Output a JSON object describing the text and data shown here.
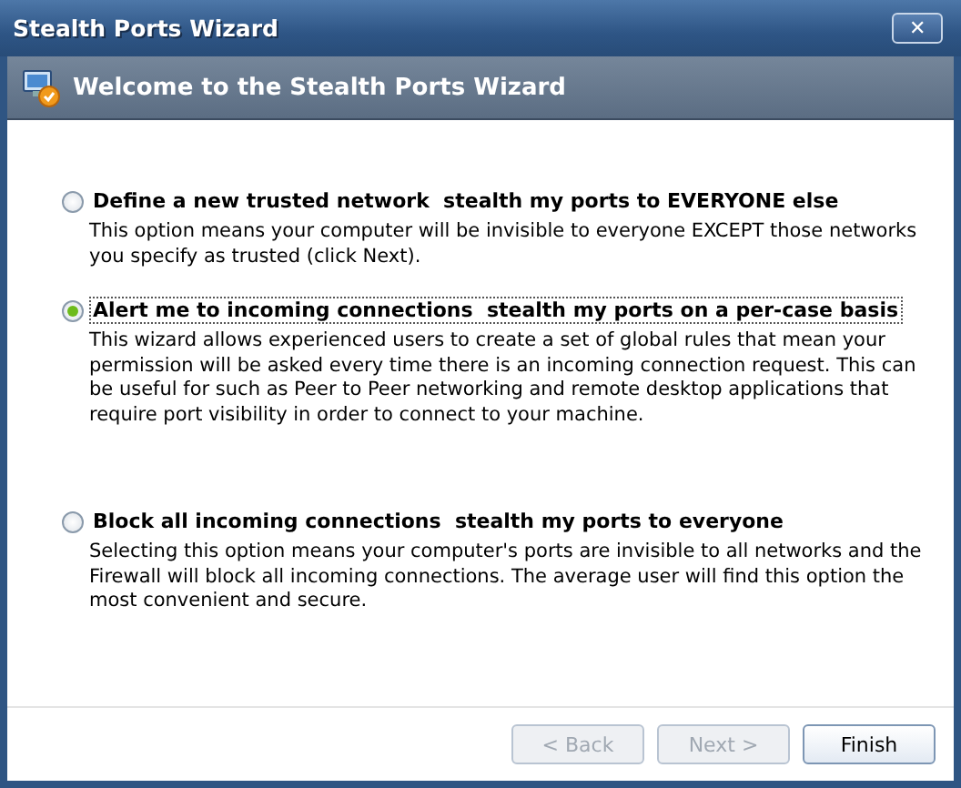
{
  "window": {
    "title": "Stealth Ports Wizard",
    "close": "✕"
  },
  "header": {
    "title": "Welcome to the Stealth Ports Wizard"
  },
  "options": [
    {
      "label": "Define a new trusted network  stealth my ports to EVERYONE else",
      "description": "This option means your computer will be invisible to everyone EXCEPT those networks you specify as trusted (click Next).",
      "selected": false
    },
    {
      "label": "Alert me to incoming connections  stealth my ports on a per-case basis",
      "description": "This wizard allows experienced users to create a set of global rules that mean your permission will be asked every time there is an incoming connection request. This can be useful for such as Peer to Peer networking and remote desktop applications that require port visibility in order to connect to your machine.",
      "selected": true
    },
    {
      "label": "Block all incoming connections  stealth my ports to everyone",
      "description": "Selecting this option means your computer's ports are invisible to all networks and the Firewall will block all incoming connections. The average user will find this option the most convenient and secure.",
      "selected": false
    }
  ],
  "buttons": [
    {
      "label": "< Back",
      "disabled": true
    },
    {
      "label": "Next >",
      "disabled": true
    },
    {
      "label": "Finish",
      "disabled": false
    }
  ]
}
